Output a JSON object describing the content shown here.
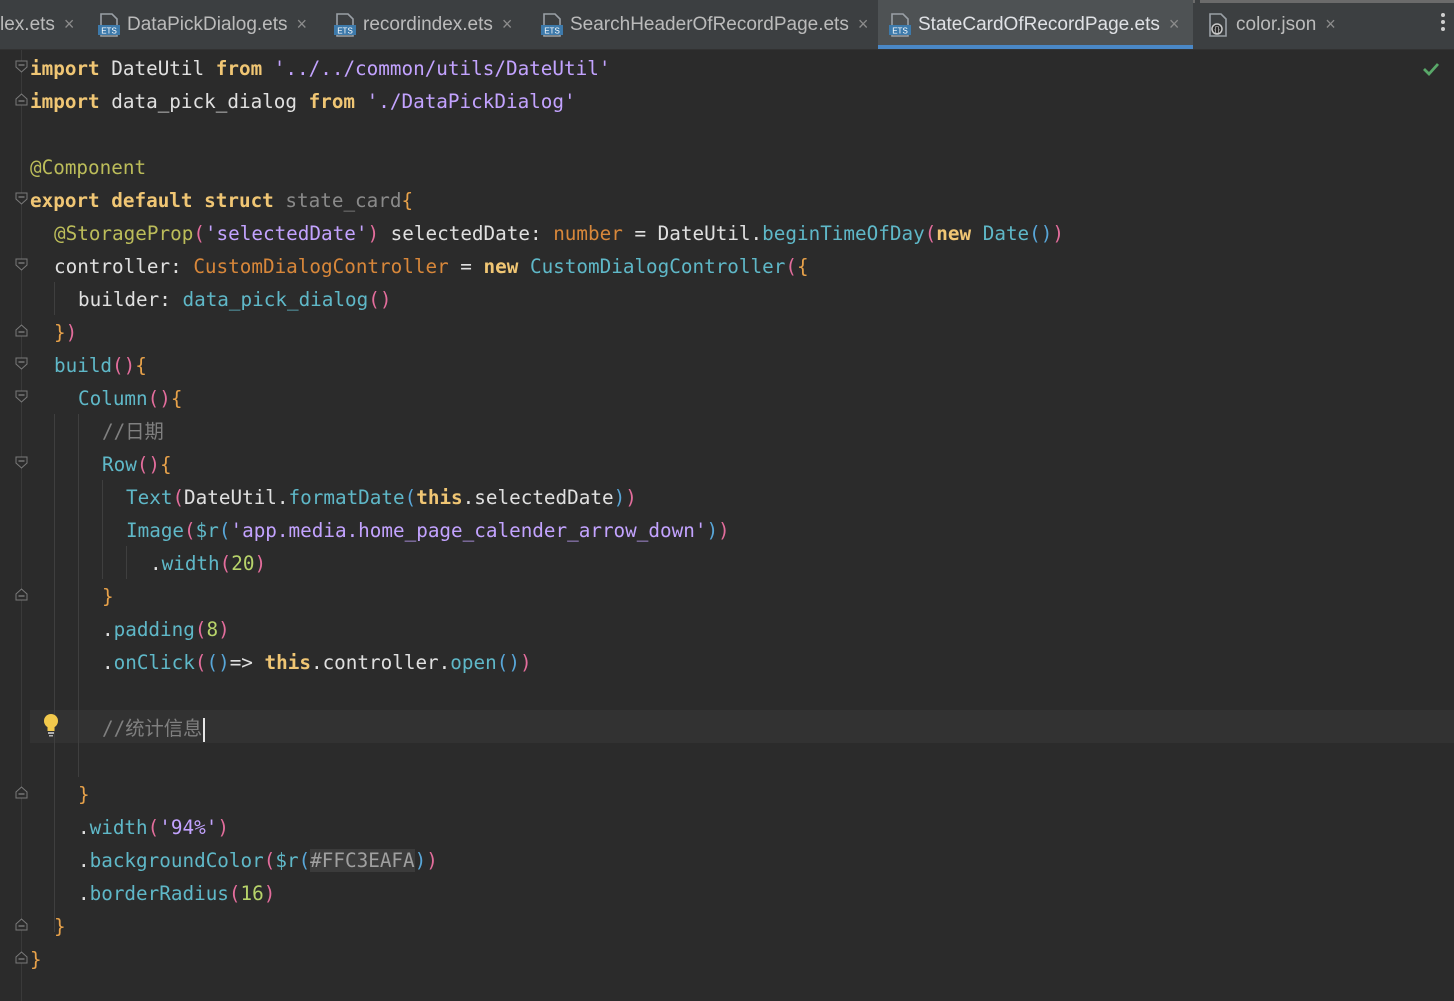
{
  "tabs": [
    {
      "label": "lex.ets",
      "active": false
    },
    {
      "label": "DataPickDialog.ets",
      "active": false
    },
    {
      "label": "recordindex.ets",
      "active": false
    },
    {
      "label": "SearchHeaderOfRecordPage.ets",
      "active": false
    },
    {
      "label": "StateCardOfRecordPage.ets",
      "active": true
    },
    {
      "label": "color.json",
      "active": false
    }
  ],
  "tab_close_glyph": "×",
  "tab_icon_badge": "ETS",
  "colors": {
    "background": "#2b2b2b",
    "tab_bar": "#3c3f41",
    "active_tab_underline": "#4a88c7",
    "check_ok": "#59a869"
  },
  "editor": {
    "status_icon": "check-icon",
    "lines": {
      "l1": {
        "kw": "import",
        "a": " DateUtil ",
        "kw2": "from",
        "str": " '../../common/utils/DateUtil'"
      },
      "l2": {
        "kw": "import",
        "a": " data_pick_dialog ",
        "kw2": "from",
        "str": " './DataPickDialog'"
      },
      "l4": {
        "deco": "@Component"
      },
      "l5": {
        "kw1": "export",
        "kw2": " default",
        "kw3": " struct",
        "name": " state_card",
        "brace": "{"
      },
      "l6": {
        "deco": "@StorageProp",
        "p1": "(",
        "str": "'selectedDate'",
        "p2": ")",
        "a": " selectedDate: ",
        "ty": "number",
        "b": " = DateUtil.",
        "fn": "beginTimeOfDay",
        "p3": "(",
        "kw": "new",
        "cls": " Date",
        "p4": "()",
        "p5": ")"
      },
      "l7": {
        "a": "controller: ",
        "ty": "CustomDialogController",
        "b": " = ",
        "kw": "new",
        "cls": " CustomDialogController",
        "p1": "(",
        "p2": "{"
      },
      "l8": {
        "a": "builder: ",
        "fn": "data_pick_dialog",
        "p": "()"
      },
      "l9": {
        "p1": "}",
        "p2": ")"
      },
      "l10": {
        "fn": "build",
        "p": "()",
        "brace": "{"
      },
      "l11": {
        "fn": "Column",
        "p": "()",
        "brace": "{"
      },
      "l12": {
        "cmt": "//日期"
      },
      "l13": {
        "fn": "Row",
        "p": "()",
        "brace": "{"
      },
      "l14": {
        "fn": "Text",
        "p1": "(",
        "a": "DateUtil.",
        "fn2": "formatDate",
        "p2": "(",
        "kw": "this",
        "b": ".selectedDate",
        "p3": ")",
        "p4": ")"
      },
      "l15": {
        "fn": "Image",
        "p1": "(",
        "fn2": "$r",
        "p2": "(",
        "str": "'app.media.home_page_calender_arrow_down'",
        "p3": ")",
        "p4": ")"
      },
      "l16": {
        "dot": ".",
        "fn": "width",
        "p1": "(",
        "num": "20",
        "p2": ")"
      },
      "l17": {
        "brace": "}"
      },
      "l18": {
        "dot": ".",
        "fn": "padding",
        "p1": "(",
        "num": "8",
        "p2": ")"
      },
      "l19": {
        "dot": ".",
        "fn": "onClick",
        "p1": "(",
        "p2": "()",
        "arrow": "=> ",
        "kw": "this",
        "a": ".controller.",
        "fn2": "open",
        "p3": "()",
        "p4": ")"
      },
      "l21": {
        "cmt": "//统计信息"
      },
      "l23": {
        "brace": "}"
      },
      "l24": {
        "dot": ".",
        "fn": "width",
        "p1": "(",
        "str": "'94%'",
        "p2": ")"
      },
      "l25": {
        "dot": ".",
        "fn": "backgroundColor",
        "p1": "(",
        "fn2": "$r",
        "p2": "(",
        "hex": "#FFC3EAFA",
        "p3": ")",
        "p4": ")"
      },
      "l26": {
        "dot": ".",
        "fn": "borderRadius",
        "p1": "(",
        "num": "16",
        "p2": ")"
      },
      "l27": {
        "brace": "}"
      },
      "l28": {
        "brace": "}"
      }
    }
  }
}
